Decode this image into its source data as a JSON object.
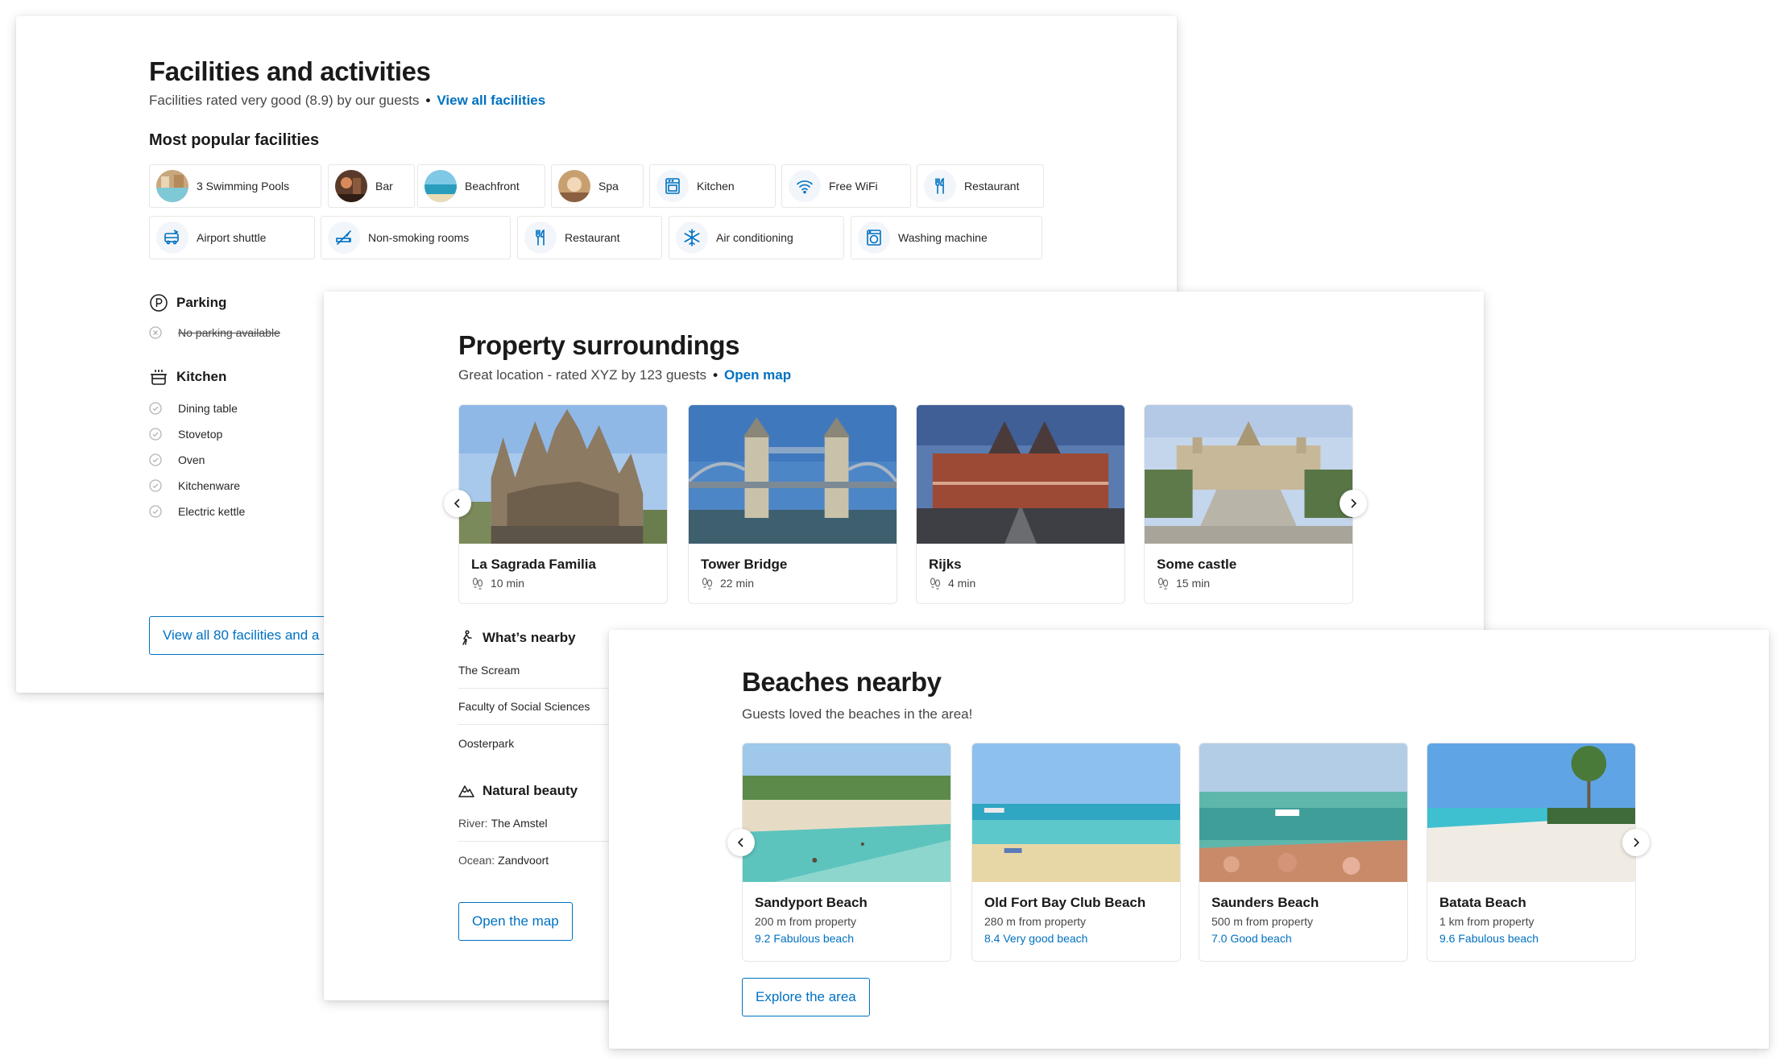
{
  "facilities": {
    "title": "Facilities and activities",
    "subtitle": "Facilities rated very good (8.9) by our guests",
    "view_all_link": "View all facilities",
    "popular_heading": "Most popular facilities",
    "popular": [
      {
        "label": "3 Swimming Pools",
        "icon": "pool-photo"
      },
      {
        "label": "Bar",
        "icon": "bar-photo"
      },
      {
        "label": "Beachfront",
        "icon": "beach-photo"
      },
      {
        "label": "Spa",
        "icon": "spa-photo"
      },
      {
        "label": "Kitchen",
        "icon": "oven-icon"
      },
      {
        "label": "Free WiFi",
        "icon": "wifi-icon"
      },
      {
        "label": "Restaurant",
        "icon": "cutlery-icon"
      },
      {
        "label": "Airport shuttle",
        "icon": "shuttle-icon"
      },
      {
        "label": "Non-smoking rooms",
        "icon": "no-smoking-icon"
      },
      {
        "label": "Restaurant",
        "icon": "cutlery-icon"
      },
      {
        "label": "Air conditioning",
        "icon": "snowflake-icon"
      },
      {
        "label": "Washing machine",
        "icon": "washing-machine-icon"
      }
    ],
    "parking": {
      "heading": "Parking",
      "items": [
        "No parking available"
      ]
    },
    "kitchen": {
      "heading": "Kitchen",
      "items": [
        "Dining table",
        "Stovetop",
        "Oven",
        "Kitchenware",
        "Electric kettle"
      ]
    },
    "view_all_button": "View all 80 facilities and a"
  },
  "surroundings": {
    "title": "Property surroundings",
    "subtitle": "Great location - rated XYZ by 123 guests",
    "map_link": "Open map",
    "places": [
      {
        "name": "La Sagrada Familia",
        "time": "10 min"
      },
      {
        "name": "Tower Bridge",
        "time": "22 min"
      },
      {
        "name": "Rijks",
        "time": "4 min"
      },
      {
        "name": "Some castle",
        "time": "15 min"
      }
    ],
    "nearby_heading": "What’s nearby",
    "nearby": [
      "The Scream",
      "Faculty of Social Sciences",
      "Oosterpark"
    ],
    "beauty_heading": "Natural beauty",
    "beauty": [
      {
        "label": "River:",
        "value": "The Amstel"
      },
      {
        "label": "Ocean:",
        "value": "Zandvoort"
      }
    ],
    "open_map_button": "Open the map"
  },
  "beaches": {
    "title": "Beaches nearby",
    "subtitle": "Guests loved the beaches in the area!",
    "items": [
      {
        "name": "Sandyport Beach",
        "distance": "200 m from property",
        "rating": "9.2 Fabulous beach"
      },
      {
        "name": "Old Fort Bay Club Beach",
        "distance": "280 m from property",
        "rating": "8.4 Very good beach"
      },
      {
        "name": "Saunders Beach",
        "distance": "500 m from property",
        "rating": "7.0 Good beach"
      },
      {
        "name": "Batata Beach",
        "distance": "1 km from property",
        "rating": "9.6 Fabulous beach"
      }
    ],
    "explore_button": "Explore the area"
  },
  "colors": {
    "link": "#0071c2",
    "icon_bg": "#f2f6fa",
    "border": "#e7e7e7"
  }
}
